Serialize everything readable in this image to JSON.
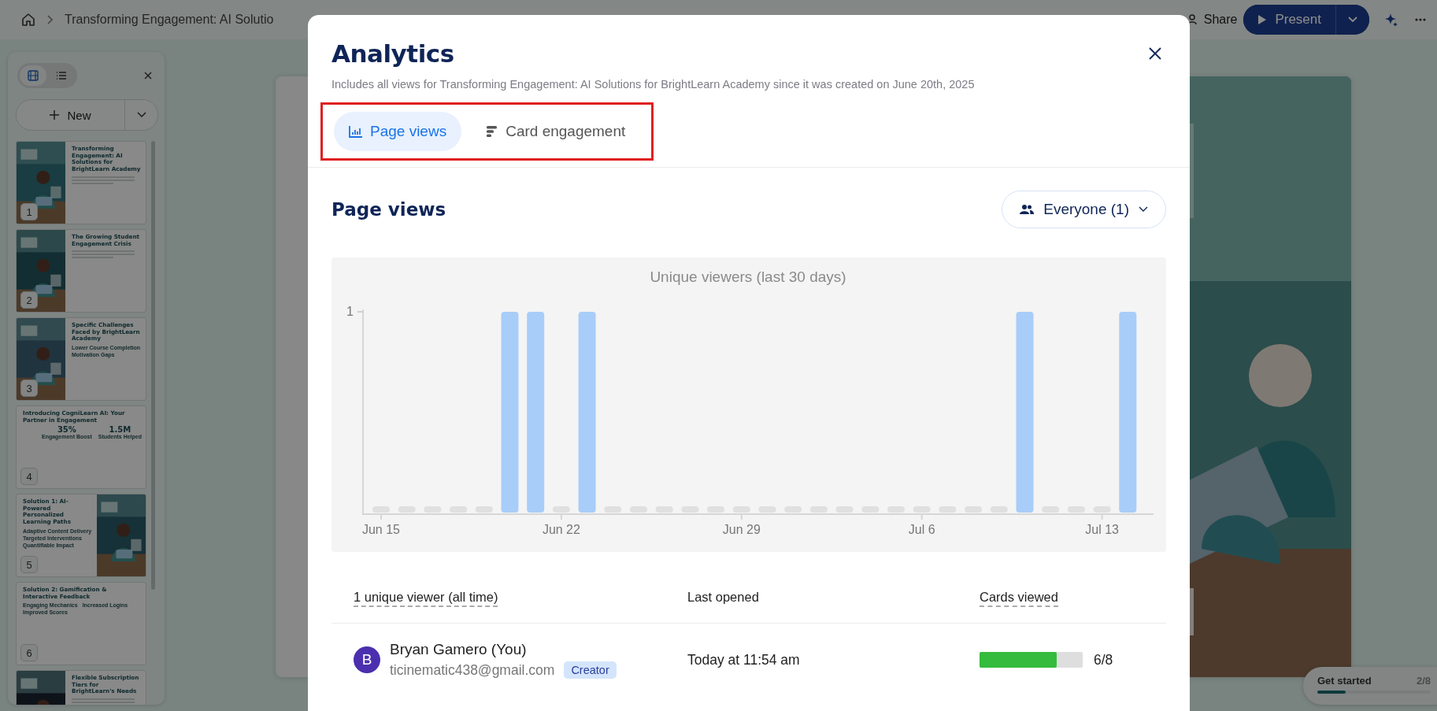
{
  "top_bar": {
    "breadcrumb_title": "Transforming Engagement: AI Solutio",
    "share_label": "Share",
    "present_label": "Present"
  },
  "sidebar": {
    "view_modes": [
      {
        "kind": "grid",
        "selected": true
      },
      {
        "kind": "list",
        "selected": false
      }
    ],
    "new_label": "New",
    "slides": [
      {
        "number": "1",
        "title": "Transforming Engagement: AI Solutions for BrightLearn Academy"
      },
      {
        "number": "2",
        "title": "The Growing Student Engagement Crisis"
      },
      {
        "number": "3",
        "title": "Specific Challenges Faced by BrightLearn Academy",
        "labels": [
          "Lower Course Completion",
          "Motivation Gaps"
        ]
      },
      {
        "number": "4",
        "title": "Introducing CogniLearn AI: Your Partner in Engagement",
        "kind": "text",
        "stats": [
          {
            "value": "35%",
            "label": "Engagement Boost"
          },
          {
            "value": "1.5M",
            "label": "Students Helped"
          }
        ]
      },
      {
        "number": "5",
        "title": "Solution 1: AI-Powered Personalized Learning Paths",
        "kind": "flipped",
        "labels": [
          "Adaptive Content Delivery",
          "Targeted Interventions",
          "Quantifiable Impact"
        ]
      },
      {
        "number": "6",
        "title": "Solution 2: Gamification & Interactive Feedback",
        "kind": "text",
        "labels": [
          "Engaging Mechanics",
          "Increased Logins",
          "Improved Scores"
        ]
      },
      {
        "title": "Flexible Subscription Tiers for BrightLearn's Needs"
      }
    ]
  },
  "get_started": {
    "label": "Get started",
    "count": "2/8",
    "level": 0.25
  },
  "modal": {
    "title": "Analytics",
    "subtitle": "Includes all views for Transforming Engagement: AI Solutions for BrightLearn Academy since it was created on June 20th, 2025",
    "tabs": [
      {
        "label": "Page views",
        "kind": "chart",
        "selected": true
      },
      {
        "label": "Card engagement",
        "kind": "engagement",
        "selected": false
      }
    ],
    "section_title": "Page views",
    "audience_filter": "Everyone (1)",
    "chart_data": {
      "type": "bar",
      "title": "Unique viewers (last 30 days)",
      "categories": [
        "Jun 15",
        null,
        null,
        null,
        null,
        null,
        null,
        "Jun 22",
        null,
        null,
        null,
        null,
        null,
        null,
        "Jun 29",
        null,
        null,
        null,
        null,
        null,
        null,
        "Jul 6",
        null,
        null,
        null,
        null,
        null,
        null,
        "Jul 13",
        null
      ],
      "values": [
        0,
        0,
        0,
        0,
        0,
        1,
        1,
        0,
        1,
        0,
        0,
        0,
        0,
        0,
        0,
        0,
        0,
        0,
        0,
        0,
        0,
        0,
        0,
        0,
        0,
        1,
        0,
        0,
        0,
        1
      ],
      "ylim": [
        0,
        1
      ],
      "yticks": [
        1
      ]
    },
    "table": {
      "columns": [
        {
          "label": "1 unique viewer (all time)",
          "dashed": true
        },
        {
          "label": "Last opened",
          "dashed": false
        },
        {
          "label": "Cards viewed",
          "dashed": true
        }
      ],
      "rows": [
        {
          "initial": "B",
          "name": "Bryan Gamero (You)",
          "email": "ticinematic438@gmail.com",
          "badge": "Creator",
          "last_opened": "Today at 11:54 am",
          "level": 0.75,
          "cards": "6/8"
        }
      ]
    }
  }
}
